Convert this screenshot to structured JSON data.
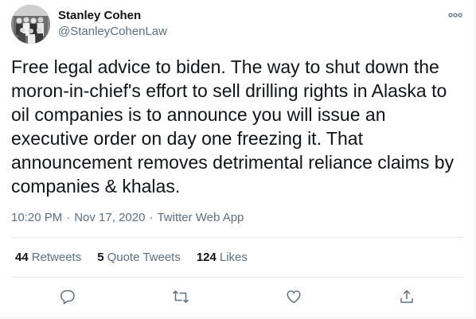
{
  "author": {
    "name": "Stanley Cohen",
    "handle": "@StanleyCohenLaw"
  },
  "tweet": {
    "text": "Free legal advice to biden. The way to shut down the\nmoron-in-chief's effort to sell drilling rights in Alaska to\noil companies is to announce you will issue an\nexecutive order on day one freezing it. That\nannouncement removes detrimental reliance claims by\ncompanies & khalas."
  },
  "meta": {
    "time": "10:20 PM",
    "date": "Nov 17, 2020",
    "source": "Twitter Web App",
    "separator": "·"
  },
  "stats": {
    "retweets_count": "44",
    "retweets_label": "Retweets",
    "quote_tweets_count": "5",
    "quote_tweets_label": "Quote Tweets",
    "likes_count": "124",
    "likes_label": "Likes"
  },
  "icons": {
    "more": "more-options-icon",
    "reply": "reply-icon",
    "retweet": "retweet-icon",
    "like": "heart-icon",
    "share": "share-icon"
  },
  "colors": {
    "text": "#0f1419",
    "secondary": "#5b7083",
    "divider": "#e6ecf0"
  }
}
